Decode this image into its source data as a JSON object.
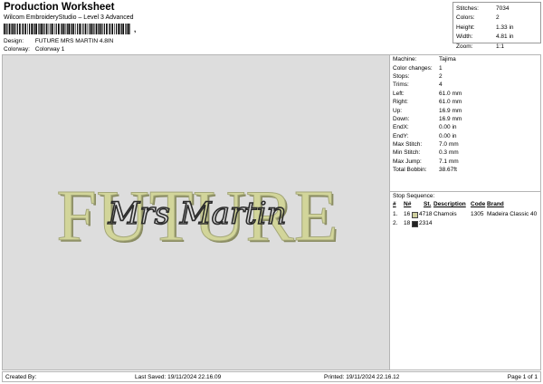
{
  "header": {
    "title": "Production Worksheet",
    "subtitle": "Wilcom EmbroideryStudio – Level 3 Advanced",
    "barcode_suffix": ",",
    "design_label": "Design:",
    "design_value": "FUTURE MRS MARTIN 4.8IN",
    "colorway_label": "Colorway:",
    "colorway_value": "Colorway 1"
  },
  "stats": [
    {
      "label": "Stitches:",
      "value": "7034"
    },
    {
      "label": "Colors:",
      "value": "2"
    },
    {
      "label": "Height:",
      "value": "1.33 in"
    },
    {
      "label": "Width:",
      "value": "4.81 in"
    },
    {
      "label": "Zoom:",
      "value": "1:1"
    }
  ],
  "design_preview": {
    "main_text": "FUTURE",
    "script_text": "Mrs Martin",
    "main_color": "#d2d59a",
    "script_color": "#2b2b2b",
    "background_color": "#dddddd"
  },
  "machine_info": [
    {
      "label": "Machine:",
      "value": "Tajima"
    },
    {
      "label": "Color changes:",
      "value": "1"
    },
    {
      "label": "Stops:",
      "value": "2"
    },
    {
      "label": "Trims:",
      "value": "4"
    },
    {
      "label": "Left:",
      "value": "61.0 mm"
    },
    {
      "label": "Right:",
      "value": "61.0 mm"
    },
    {
      "label": "Up:",
      "value": "16.9 mm"
    },
    {
      "label": "Down:",
      "value": "16.9 mm"
    },
    {
      "label": "EndX:",
      "value": "0.00 in"
    },
    {
      "label": "EndY:",
      "value": "0.00 in"
    },
    {
      "label": "Max Stitch:",
      "value": "7.0 mm"
    },
    {
      "label": "Min Stitch:",
      "value": "0.3 mm"
    },
    {
      "label": "Max Jump:",
      "value": "7.1 mm"
    },
    {
      "label": "Total Bobbin:",
      "value": "38.67ft"
    }
  ],
  "stop_sequence": {
    "title": "Stop Sequence:",
    "columns": {
      "num": "#",
      "needle": "N#",
      "st": "St.",
      "description": "Description",
      "code": "Code",
      "brand": "Brand"
    },
    "rows": [
      {
        "num": "1.",
        "needle": "16",
        "st": "4718",
        "description": "Chamois",
        "code": "1305",
        "brand": "Madeira Classic 40",
        "color": "#cfcf9e"
      },
      {
        "num": "2.",
        "needle": "18",
        "st": "2314",
        "description": "",
        "code": "",
        "brand": "",
        "color": "#222222"
      }
    ]
  },
  "footer": {
    "created_by": "Created By:",
    "last_saved": "Last Saved: 19/11/2024 22.16.09",
    "printed": "Printed: 19/11/2024 22.16.12",
    "page": "Page 1 of 1"
  }
}
